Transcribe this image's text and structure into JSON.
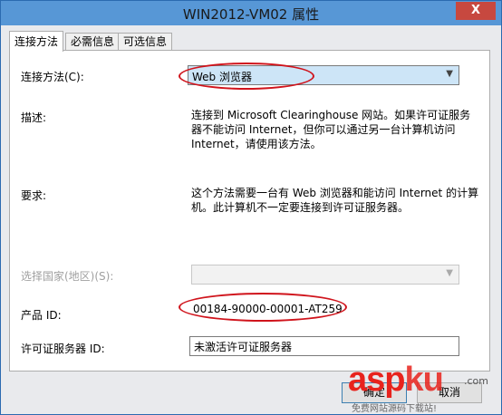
{
  "window": {
    "title": "WIN2012-VM02 属性",
    "close_glyph": "X"
  },
  "tabs": [
    {
      "label": "连接方法",
      "active": true
    },
    {
      "label": "必需信息",
      "active": false
    },
    {
      "label": "可选信息",
      "active": false
    }
  ],
  "form": {
    "connection_method": {
      "label": "连接方法(C):",
      "value": "Web 浏览器"
    },
    "description": {
      "label": "描述:",
      "text": "连接到 Microsoft Clearinghouse 网站。如果许可证服务器不能访问 Internet，但你可以通过另一台计算机访问 Internet，请使用该方法。"
    },
    "requirements": {
      "label": "要求:",
      "text": "这个方法需要一台有 Web 浏览器和能访问 Internet 的计算机。此计算机不一定要连接到许可证服务器。"
    },
    "country": {
      "label": "选择国家(地区)(S):",
      "value": ""
    },
    "product_id": {
      "label": "产品 ID:",
      "value": "00184-90000-00001-AT259"
    },
    "license_server_id": {
      "label": "许可证服务器 ID:",
      "value": "未激活许可证服务器"
    }
  },
  "buttons": {
    "ok": "确定",
    "cancel": "取消"
  },
  "watermark": {
    "brand": "asp",
    "brand_suffix": "ku",
    "dot": ".com",
    "tagline": "免费网站源码下载站!"
  },
  "colors": {
    "titlebar": "#5797d6",
    "highlight_ellipse": "#d0141c",
    "dropdown_selected": "#cde5f7",
    "watermark": "#e8231d"
  }
}
